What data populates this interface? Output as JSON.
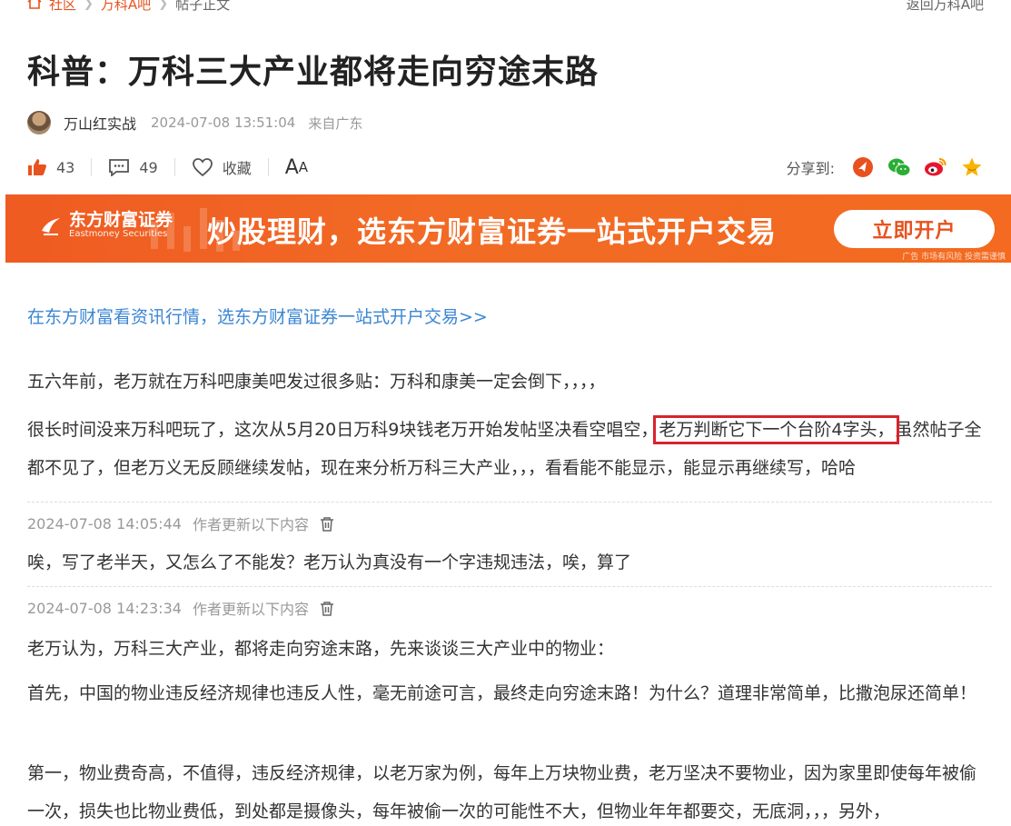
{
  "breadcrumb": {
    "items": [
      "社区",
      "万科A吧",
      "帖子正文"
    ],
    "back_label": "返回万科A吧"
  },
  "post": {
    "title": "科普：万科三大产业都将走向穷途末路",
    "author": "万山红实战",
    "time": "2024-07-08 13:51:04",
    "location": "来自广东"
  },
  "actions": {
    "likes": "43",
    "comments": "49",
    "favorite_label": "收藏",
    "font_size_big": "A",
    "font_size_small": "A",
    "share_label": "分享到:"
  },
  "banner": {
    "brand": "东方财富证券",
    "brand_en": "Eastmoney Securities",
    "slogan": "炒股理财，选东方财富证券一站式开户交易",
    "button": "立即开户",
    "disclaimer": "广告 市场有风险 投资需谨慎"
  },
  "article": {
    "promo_link": "在东方财富看资讯行情，选东方财富证券一站式开户交易>>",
    "p1": "五六年前，老万就在万科吧康美吧发过很多贴：万科和康美一定会倒下，，，，",
    "p2_before": "很长时间没来万科吧玩了，这次从5月20日万科9块钱老万开始发帖坚决看空唱空，",
    "p2_highlight": "老万判断它下一个台阶4字头，",
    "p2_after": "虽然帖子全都不见了，但老万义无反顾继续发帖，现在来分析万科三大产业，，，看看能不能显示，能显示再继续写，哈哈",
    "updates": [
      {
        "time": "2024-07-08 14:05:44",
        "label": "作者更新以下内容",
        "text": "唉，写了老半天，又怎么了不能发？老万认为真没有一个字违规违法，唉，算了"
      },
      {
        "time": "2024-07-08 14:23:34",
        "label": "作者更新以下内容",
        "text": "老万认为，万科三大产业，都将走向穷途末路，先来谈谈三大产业中的物业："
      }
    ],
    "p3": "首先，中国的物业违反经济规律也违反人性，毫无前途可言，最终走向穷途末路！为什么？道理非常简单，比撒泡尿还简单！",
    "p4": "第一，物业费奇高，不值得，违反经济规律，以老万家为例，每年上万块物业费，老万坚决不要物业，因为家里即使每年被偷一次，损失也比物业费低，到处都是摄像头，每年被偷一次的可能性不大，但物业年年都要交，无底洞，，，另外，"
  },
  "colors": {
    "accent": "#e8521e",
    "link": "#3b86d3",
    "highlight_border": "#d9232d"
  }
}
